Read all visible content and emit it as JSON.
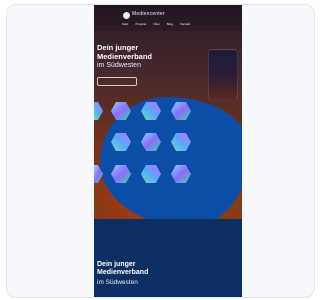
{
  "header": {
    "logo_text": "Mediencenter",
    "nav_items": [
      "Start",
      "Projekte",
      "Über",
      "Blog",
      "Kontakt"
    ]
  },
  "hero": {
    "title": "Dein junger Medienverband",
    "subtitle": "im Südwesten",
    "cta_label": ""
  },
  "lower_section": {
    "title": "Dein junger Medienverband",
    "subtitle": "im Südwesten"
  },
  "colors": {
    "accent_blue": "#0b4ea8",
    "navy": "#0b2f63",
    "hero_orange": "#a53d16"
  }
}
